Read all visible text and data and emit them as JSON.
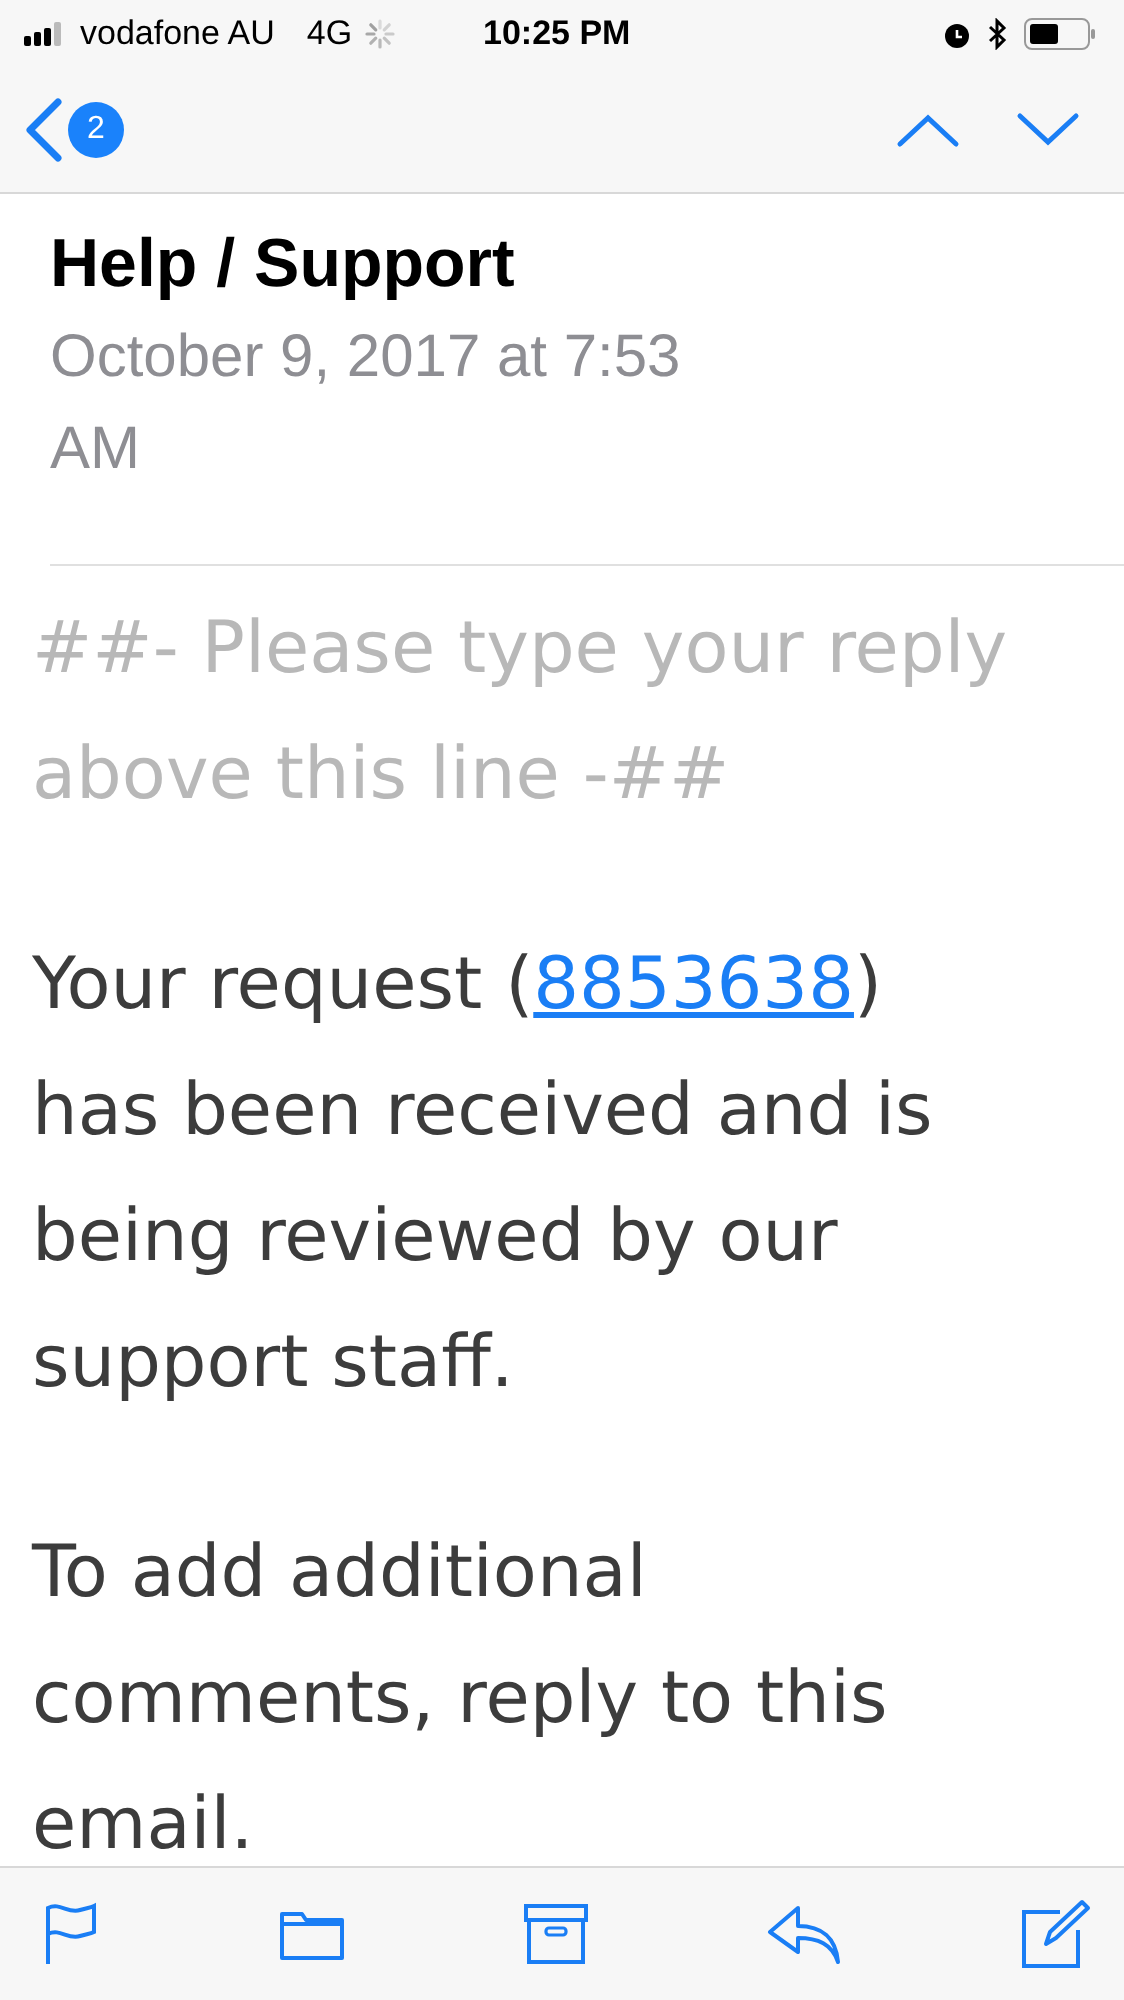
{
  "status_bar": {
    "carrier": "vodafone AU",
    "network": "4G",
    "time": "10:25 PM"
  },
  "nav": {
    "unread_count": "2"
  },
  "message": {
    "subject": "Help / Support",
    "date": "October 9, 2017 at 7:53 AM",
    "body": [
      {
        "kind": "quote",
        "text": "##- Please type your reply above this line -##"
      },
      {
        "kind": "link_paragraph",
        "before": "Your request (",
        "link": "8853638",
        "after": ") has been received and is being reviewed by our support staff."
      },
      {
        "kind": "paragraph",
        "text": "To add additional comments, reply to this email."
      }
    ]
  }
}
